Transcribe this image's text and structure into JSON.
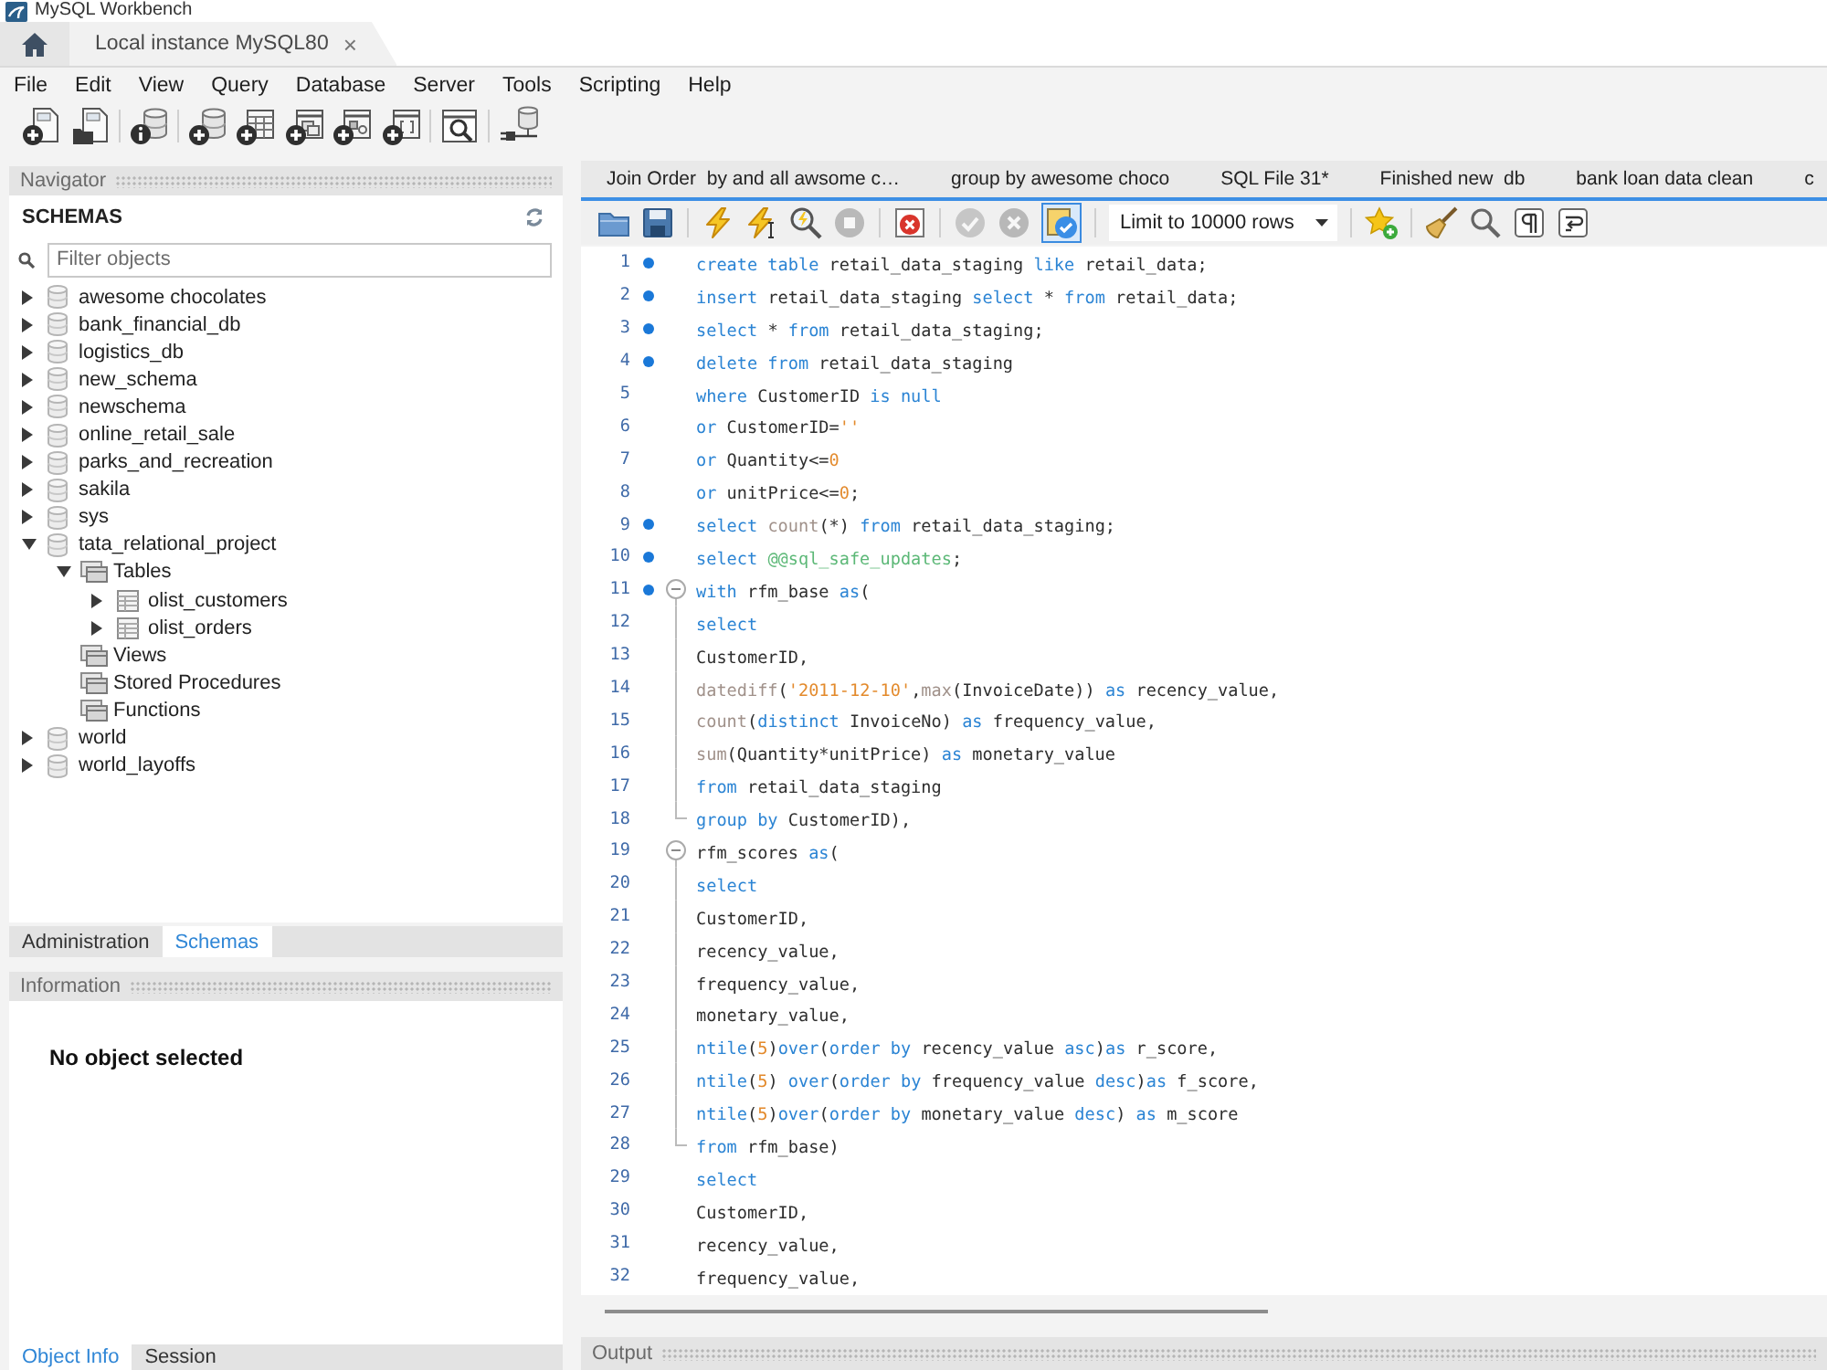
{
  "window": {
    "title": "MySQL Workbench"
  },
  "connection_tabs": [
    {
      "label": "Local instance MySQL80",
      "close": "×",
      "selected": true
    }
  ],
  "menu": [
    "File",
    "Edit",
    "View",
    "Query",
    "Database",
    "Server",
    "Tools",
    "Scripting",
    "Help"
  ],
  "toolbar": [
    {
      "kind": "new_query"
    },
    {
      "kind": "open_query"
    },
    {
      "kind": "separator"
    },
    {
      "kind": "inspector"
    },
    {
      "kind": "separator"
    },
    {
      "kind": "create_schema"
    },
    {
      "kind": "create_table"
    },
    {
      "kind": "create_view"
    },
    {
      "kind": "create_procedure"
    },
    {
      "kind": "create_function"
    },
    {
      "kind": "separator"
    },
    {
      "kind": "search_data"
    },
    {
      "kind": "separator"
    },
    {
      "kind": "reconnect"
    }
  ],
  "navigator": {
    "title": "Navigator",
    "section": "SCHEMAS",
    "filter": {
      "placeholder": "Filter objects"
    },
    "schemas": [
      {
        "label": "awesome chocolates",
        "kind": "schema",
        "expandable": true,
        "expanded": false
      },
      {
        "label": "bank_financial_db",
        "kind": "schema",
        "expandable": true,
        "expanded": false
      },
      {
        "label": "logistics_db",
        "kind": "schema",
        "expandable": true,
        "expanded": false
      },
      {
        "label": "new_schema",
        "kind": "schema",
        "expandable": true,
        "expanded": false
      },
      {
        "label": "newschema",
        "kind": "schema",
        "expandable": true,
        "expanded": false
      },
      {
        "label": "online_retail_sale",
        "kind": "schema",
        "expandable": true,
        "expanded": false
      },
      {
        "label": "parks_and_recreation",
        "kind": "schema",
        "expandable": true,
        "expanded": false
      },
      {
        "label": "sakila",
        "kind": "schema",
        "expandable": true,
        "expanded": false
      },
      {
        "label": "sys",
        "kind": "schema",
        "expandable": true,
        "expanded": false
      },
      {
        "label": "tata_relational_project",
        "kind": "schema",
        "expandable": true,
        "expanded": true,
        "children": [
          {
            "label": "Tables",
            "kind": "folder",
            "expandable": true,
            "expanded": true,
            "children": [
              {
                "label": "olist_customers",
                "kind": "table",
                "expandable": true,
                "expanded": false
              },
              {
                "label": "olist_orders",
                "kind": "table",
                "expandable": true,
                "expanded": false
              }
            ]
          },
          {
            "label": "Views",
            "kind": "folder",
            "expandable": false
          },
          {
            "label": "Stored Procedures",
            "kind": "folder",
            "expandable": false
          },
          {
            "label": "Functions",
            "kind": "folder",
            "expandable": false
          }
        ]
      },
      {
        "label": "world",
        "kind": "schema",
        "expandable": true,
        "expanded": false
      },
      {
        "label": "world_layoffs",
        "kind": "schema",
        "expandable": true,
        "expanded": false
      }
    ]
  },
  "navigator_tabs": [
    {
      "label": "Administration",
      "selected": false
    },
    {
      "label": "Schemas",
      "selected": true
    }
  ],
  "information": {
    "title": "Information",
    "message": "No object selected"
  },
  "information_tabs": [
    {
      "label": "Object Info",
      "selected": true
    },
    {
      "label": "Session",
      "selected": false
    }
  ],
  "editor_tabs": [
    {
      "label": "Join Order  by and all awsome c…",
      "selected": false
    },
    {
      "label": "group by awesome choco",
      "selected": false
    },
    {
      "label": "SQL File 31*",
      "selected": false
    },
    {
      "label": "Finished new  db",
      "selected": false
    },
    {
      "label": "bank loan data clean",
      "selected": false
    },
    {
      "label": "c",
      "selected": false
    }
  ],
  "editor_toolbar": [
    {
      "kind": "open",
      "disabled": false,
      "pressed": false
    },
    {
      "kind": "save",
      "disabled": false,
      "pressed": false
    },
    {
      "kind": "separator"
    },
    {
      "kind": "execute",
      "disabled": false,
      "pressed": false
    },
    {
      "kind": "execute_current",
      "disabled": false,
      "pressed": false
    },
    {
      "kind": "explain",
      "disabled": false,
      "pressed": false
    },
    {
      "kind": "stop",
      "disabled": true,
      "pressed": false
    },
    {
      "kind": "separator"
    },
    {
      "kind": "stop_on_error",
      "disabled": false,
      "pressed": false
    },
    {
      "kind": "separator"
    },
    {
      "kind": "commit",
      "disabled": true,
      "pressed": false
    },
    {
      "kind": "rollback",
      "disabled": true,
      "pressed": false
    },
    {
      "kind": "autocommit",
      "disabled": false,
      "pressed": true
    },
    {
      "kind": "separator"
    },
    {
      "kind": "limit",
      "label": "Limit to 10000 rows"
    },
    {
      "kind": "separator"
    },
    {
      "kind": "bookmark",
      "disabled": false,
      "pressed": false
    },
    {
      "kind": "separator"
    },
    {
      "kind": "beautify",
      "disabled": false,
      "pressed": false
    },
    {
      "kind": "find",
      "disabled": false,
      "pressed": false
    },
    {
      "kind": "invisibles",
      "disabled": false,
      "pressed": false
    },
    {
      "kind": "wrap",
      "disabled": false,
      "pressed": false
    }
  ],
  "editor": {
    "lines": [
      {
        "number": "1",
        "marker": true,
        "kind": "plain",
        "tokens": [
          {
            "kind": "keyword",
            "text": "create table"
          },
          {
            "kind": "plain",
            "text": " retail_data_staging "
          },
          {
            "kind": "keyword",
            "text": "like"
          },
          {
            "kind": "plain",
            "text": " retail_data;"
          }
        ]
      },
      {
        "number": "2",
        "marker": true,
        "kind": "plain",
        "tokens": [
          {
            "kind": "keyword",
            "text": "insert"
          },
          {
            "kind": "plain",
            "text": " retail_data_staging "
          },
          {
            "kind": "keyword",
            "text": "select"
          },
          {
            "kind": "plain",
            "text": " * "
          },
          {
            "kind": "keyword",
            "text": "from"
          },
          {
            "kind": "plain",
            "text": " retail_data;"
          }
        ]
      },
      {
        "number": "3",
        "marker": true,
        "kind": "plain",
        "tokens": [
          {
            "kind": "keyword",
            "text": "select"
          },
          {
            "kind": "plain",
            "text": " * "
          },
          {
            "kind": "keyword",
            "text": "from"
          },
          {
            "kind": "plain",
            "text": " retail_data_staging;"
          }
        ]
      },
      {
        "number": "4",
        "marker": true,
        "kind": "plain",
        "tokens": [
          {
            "kind": "keyword",
            "text": "delete from"
          },
          {
            "kind": "plain",
            "text": " retail_data_staging"
          }
        ]
      },
      {
        "number": "5",
        "marker": false,
        "kind": "plain",
        "tokens": [
          {
            "kind": "keyword",
            "text": "where"
          },
          {
            "kind": "plain",
            "text": " CustomerID "
          },
          {
            "kind": "keyword",
            "text": "is null"
          }
        ]
      },
      {
        "number": "6",
        "marker": false,
        "kind": "plain",
        "tokens": [
          {
            "kind": "keyword",
            "text": "or"
          },
          {
            "kind": "plain",
            "text": " CustomerID="
          },
          {
            "kind": "string",
            "text": "''"
          }
        ]
      },
      {
        "number": "7",
        "marker": false,
        "kind": "plain",
        "tokens": [
          {
            "kind": "keyword",
            "text": "or"
          },
          {
            "kind": "plain",
            "text": " Quantity<="
          },
          {
            "kind": "number",
            "text": "0"
          }
        ]
      },
      {
        "number": "8",
        "marker": false,
        "kind": "plain",
        "tokens": [
          {
            "kind": "keyword",
            "text": "or"
          },
          {
            "kind": "plain",
            "text": " unitPrice<="
          },
          {
            "kind": "number",
            "text": "0"
          },
          {
            "kind": "plain",
            "text": ";"
          }
        ]
      },
      {
        "number": "9",
        "marker": true,
        "kind": "plain",
        "tokens": [
          {
            "kind": "keyword",
            "text": "select "
          },
          {
            "kind": "function",
            "text": "count"
          },
          {
            "kind": "plain",
            "text": "(*) "
          },
          {
            "kind": "keyword",
            "text": "from"
          },
          {
            "kind": "plain",
            "text": " retail_data_staging;"
          }
        ]
      },
      {
        "number": "10",
        "marker": true,
        "kind": "plain",
        "tokens": [
          {
            "kind": "keyword",
            "text": "select "
          },
          {
            "kind": "variable",
            "text": "@@sql_safe_updates"
          },
          {
            "kind": "plain",
            "text": ";"
          }
        ]
      },
      {
        "number": "11",
        "marker": true,
        "kind": "foldstart",
        "tokens": [
          {
            "kind": "keyword",
            "text": "with"
          },
          {
            "kind": "plain",
            "text": " rfm_base "
          },
          {
            "kind": "keyword",
            "text": "as"
          },
          {
            "kind": "plain",
            "text": "("
          }
        ]
      },
      {
        "number": "12",
        "marker": false,
        "kind": "foldbody",
        "tokens": [
          {
            "kind": "keyword",
            "text": "select"
          }
        ]
      },
      {
        "number": "13",
        "marker": false,
        "kind": "foldbody",
        "tokens": [
          {
            "kind": "plain",
            "text": "CustomerID,"
          }
        ]
      },
      {
        "number": "14",
        "marker": false,
        "kind": "foldbody",
        "tokens": [
          {
            "kind": "function",
            "text": "datediff"
          },
          {
            "kind": "plain",
            "text": "("
          },
          {
            "kind": "string",
            "text": "'2011-12-10'"
          },
          {
            "kind": "plain",
            "text": ","
          },
          {
            "kind": "function",
            "text": "max"
          },
          {
            "kind": "plain",
            "text": "(InvoiceDate)) "
          },
          {
            "kind": "keyword",
            "text": "as"
          },
          {
            "kind": "plain",
            "text": " recency_value,"
          }
        ]
      },
      {
        "number": "15",
        "marker": false,
        "kind": "foldbody",
        "tokens": [
          {
            "kind": "function",
            "text": "count"
          },
          {
            "kind": "plain",
            "text": "("
          },
          {
            "kind": "keyword",
            "text": "distinct"
          },
          {
            "kind": "plain",
            "text": " InvoiceNo) "
          },
          {
            "kind": "keyword",
            "text": "as"
          },
          {
            "kind": "plain",
            "text": " frequency_value,"
          }
        ]
      },
      {
        "number": "16",
        "marker": false,
        "kind": "foldbody",
        "tokens": [
          {
            "kind": "function",
            "text": "sum"
          },
          {
            "kind": "plain",
            "text": "(Quantity*unitPrice) "
          },
          {
            "kind": "keyword",
            "text": "as"
          },
          {
            "kind": "plain",
            "text": " monetary_value"
          }
        ]
      },
      {
        "number": "17",
        "marker": false,
        "kind": "foldbody",
        "tokens": [
          {
            "kind": "keyword",
            "text": "from"
          },
          {
            "kind": "plain",
            "text": " retail_data_staging"
          }
        ]
      },
      {
        "number": "18",
        "marker": false,
        "kind": "foldend",
        "tokens": [
          {
            "kind": "keyword",
            "text": "group by"
          },
          {
            "kind": "plain",
            "text": " CustomerID),"
          }
        ]
      },
      {
        "number": "19",
        "marker": false,
        "kind": "foldstart",
        "tokens": [
          {
            "kind": "plain",
            "text": "rfm_scores "
          },
          {
            "kind": "keyword",
            "text": "as"
          },
          {
            "kind": "plain",
            "text": "("
          }
        ]
      },
      {
        "number": "20",
        "marker": false,
        "kind": "foldbody",
        "tokens": [
          {
            "kind": "keyword",
            "text": "select"
          }
        ]
      },
      {
        "number": "21",
        "marker": false,
        "kind": "foldbody",
        "tokens": [
          {
            "kind": "plain",
            "text": "CustomerID,"
          }
        ]
      },
      {
        "number": "22",
        "marker": false,
        "kind": "foldbody",
        "tokens": [
          {
            "kind": "plain",
            "text": "recency_value,"
          }
        ]
      },
      {
        "number": "23",
        "marker": false,
        "kind": "foldbody",
        "tokens": [
          {
            "kind": "plain",
            "text": "frequency_value,"
          }
        ]
      },
      {
        "number": "24",
        "marker": false,
        "kind": "foldbody",
        "tokens": [
          {
            "kind": "plain",
            "text": "monetary_value,"
          }
        ]
      },
      {
        "number": "25",
        "marker": false,
        "kind": "foldbody",
        "tokens": [
          {
            "kind": "keyword",
            "text": "ntile"
          },
          {
            "kind": "plain",
            "text": "("
          },
          {
            "kind": "number",
            "text": "5"
          },
          {
            "kind": "plain",
            "text": ")"
          },
          {
            "kind": "keyword",
            "text": "over"
          },
          {
            "kind": "plain",
            "text": "("
          },
          {
            "kind": "keyword",
            "text": "order by"
          },
          {
            "kind": "plain",
            "text": " recency_value "
          },
          {
            "kind": "keyword",
            "text": "asc"
          },
          {
            "kind": "plain",
            "text": ")"
          },
          {
            "kind": "keyword",
            "text": "as"
          },
          {
            "kind": "plain",
            "text": " r_score,"
          }
        ]
      },
      {
        "number": "26",
        "marker": false,
        "kind": "foldbody",
        "tokens": [
          {
            "kind": "keyword",
            "text": "ntile"
          },
          {
            "kind": "plain",
            "text": "("
          },
          {
            "kind": "number",
            "text": "5"
          },
          {
            "kind": "plain",
            "text": ") "
          },
          {
            "kind": "keyword",
            "text": "over"
          },
          {
            "kind": "plain",
            "text": "("
          },
          {
            "kind": "keyword",
            "text": "order by"
          },
          {
            "kind": "plain",
            "text": " frequency_value "
          },
          {
            "kind": "keyword",
            "text": "desc"
          },
          {
            "kind": "plain",
            "text": ")"
          },
          {
            "kind": "keyword",
            "text": "as"
          },
          {
            "kind": "plain",
            "text": " f_score,"
          }
        ]
      },
      {
        "number": "27",
        "marker": false,
        "kind": "foldbody",
        "tokens": [
          {
            "kind": "keyword",
            "text": "ntile"
          },
          {
            "kind": "plain",
            "text": "("
          },
          {
            "kind": "number",
            "text": "5"
          },
          {
            "kind": "plain",
            "text": ")"
          },
          {
            "kind": "keyword",
            "text": "over"
          },
          {
            "kind": "plain",
            "text": "("
          },
          {
            "kind": "keyword",
            "text": "order by"
          },
          {
            "kind": "plain",
            "text": " monetary_value "
          },
          {
            "kind": "keyword",
            "text": "desc"
          },
          {
            "kind": "plain",
            "text": ") "
          },
          {
            "kind": "keyword",
            "text": "as"
          },
          {
            "kind": "plain",
            "text": " m_score"
          }
        ]
      },
      {
        "number": "28",
        "marker": false,
        "kind": "foldend",
        "tokens": [
          {
            "kind": "keyword",
            "text": "from"
          },
          {
            "kind": "plain",
            "text": " rfm_base)"
          }
        ]
      },
      {
        "number": "29",
        "marker": false,
        "kind": "plain",
        "tokens": [
          {
            "kind": "keyword",
            "text": "select"
          }
        ]
      },
      {
        "number": "30",
        "marker": false,
        "kind": "plain",
        "tokens": [
          {
            "kind": "plain",
            "text": "CustomerID,"
          }
        ]
      },
      {
        "number": "31",
        "marker": false,
        "kind": "plain",
        "tokens": [
          {
            "kind": "plain",
            "text": "recency_value,"
          }
        ]
      },
      {
        "number": "32",
        "marker": false,
        "kind": "plain",
        "tokens": [
          {
            "kind": "plain",
            "text": "frequency_value,"
          }
        ]
      }
    ]
  },
  "output": {
    "title": "Output"
  }
}
